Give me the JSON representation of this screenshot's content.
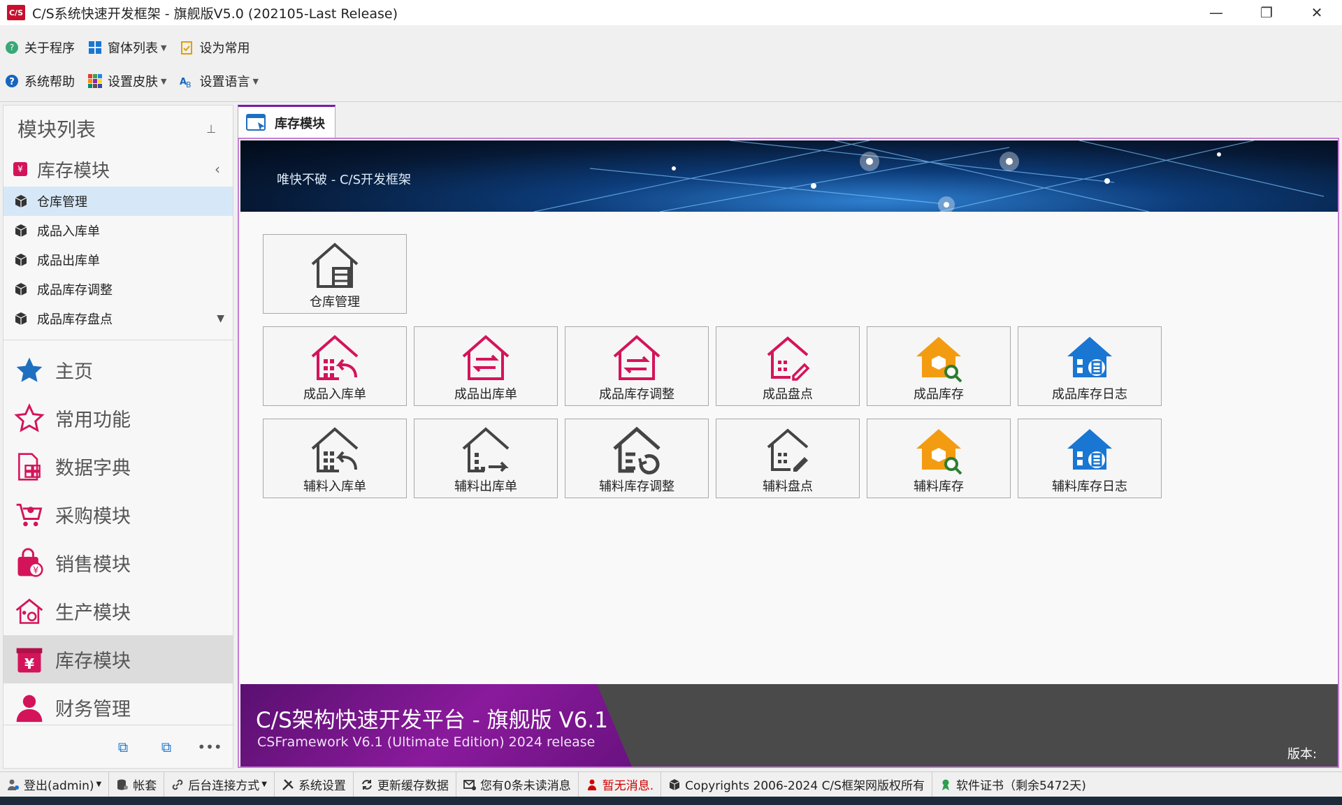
{
  "window": {
    "title": "C/S系统快速开发框架 - 旗舰版V5.0 (202105-Last Release)",
    "logo_text": "C/S",
    "minimize": "—",
    "restore": "❐",
    "close": "✕"
  },
  "toolbar": {
    "row1": [
      {
        "label": "关于程序",
        "icon": "about-icon",
        "dropdown": false
      },
      {
        "label": "窗体列表",
        "icon": "window-list-icon",
        "dropdown": true
      },
      {
        "label": "设为常用",
        "icon": "clipboard-check-icon",
        "dropdown": false
      }
    ],
    "row2": [
      {
        "label": "系统帮助",
        "icon": "help-icon",
        "dropdown": false
      },
      {
        "label": "设置皮肤",
        "icon": "skin-grid-icon",
        "dropdown": true
      },
      {
        "label": "设置语言",
        "icon": "language-icon",
        "dropdown": true
      }
    ]
  },
  "sidebar": {
    "header": "模块列表",
    "pin": "📌",
    "group": {
      "label": "库存模块",
      "collapse": "‹"
    },
    "items": [
      {
        "label": "仓库管理",
        "selected": true
      },
      {
        "label": "成品入库单",
        "selected": false
      },
      {
        "label": "成品出库单",
        "selected": false
      },
      {
        "label": "成品库存调整",
        "selected": false
      },
      {
        "label": "成品库存盘点",
        "selected": false
      }
    ],
    "nav": [
      {
        "label": "主页",
        "icon": "star-filled-icon",
        "active": false
      },
      {
        "label": "常用功能",
        "icon": "star-outline-icon",
        "active": false
      },
      {
        "label": "数据字典",
        "icon": "dictionary-icon",
        "active": false
      },
      {
        "label": "采购模块",
        "icon": "cart-icon",
        "active": false
      },
      {
        "label": "销售模块",
        "icon": "shopping-bag-icon",
        "active": false
      },
      {
        "label": "生产模块",
        "icon": "factory-icon",
        "active": false
      },
      {
        "label": "库存模块",
        "icon": "inventory-icon",
        "active": true
      },
      {
        "label": "财务管理",
        "icon": "person-icon",
        "active": false
      }
    ],
    "footer_more": "•••"
  },
  "tab": {
    "label": "库存模块"
  },
  "banner": {
    "slogan": "唯快不破 - C/S开发框架"
  },
  "tiles": [
    {
      "label": "仓库管理",
      "icon": "warehouse-icon",
      "color": "#444444"
    },
    {
      "label": "成品入库单",
      "icon": "product-in-icon",
      "color": "#d4145a"
    },
    {
      "label": "成品出库单",
      "icon": "product-out-icon",
      "color": "#d4145a"
    },
    {
      "label": "成品库存调整",
      "icon": "product-adjust-icon",
      "color": "#d4145a"
    },
    {
      "label": "成品盘点",
      "icon": "product-count-icon",
      "color": "#d4145a"
    },
    {
      "label": "成品库存",
      "icon": "product-stock-search-icon",
      "color": "#f39c12"
    },
    {
      "label": "成品库存日志",
      "icon": "product-stock-log-icon",
      "color": "#1976d2"
    },
    {
      "label": "辅料入库单",
      "icon": "material-in-icon",
      "color": "#444444"
    },
    {
      "label": "辅料出库单",
      "icon": "material-out-icon",
      "color": "#444444"
    },
    {
      "label": "辅料库存调整",
      "icon": "material-adjust-icon",
      "color": "#444444"
    },
    {
      "label": "辅料盘点",
      "icon": "material-count-icon",
      "color": "#444444"
    },
    {
      "label": "辅料库存",
      "icon": "material-stock-search-icon",
      "color": "#f39c12"
    },
    {
      "label": "辅料库存日志",
      "icon": "material-stock-log-icon",
      "color": "#1976d2"
    }
  ],
  "bottom_banner": {
    "title": "C/S架构快速开发平台 - 旗舰版 V6.1",
    "subtitle": "CSFramework V6.1 (Ultimate Edition) 2024 release",
    "version_label": "版本:"
  },
  "statusbar": [
    {
      "label": "登出(admin)",
      "icon": "user-gear-icon",
      "dropdown": true,
      "red": false
    },
    {
      "label": "帐套",
      "icon": "database-icon",
      "dropdown": false,
      "red": false
    },
    {
      "label": "后台连接方式",
      "icon": "link-icon",
      "dropdown": true,
      "red": false
    },
    {
      "label": "系统设置",
      "icon": "tools-icon",
      "dropdown": false,
      "red": false
    },
    {
      "label": "更新缓存数据",
      "icon": "refresh-icon",
      "dropdown": false,
      "red": false
    },
    {
      "label": "您有0条未读消息",
      "icon": "mail-icon",
      "dropdown": false,
      "red": false
    },
    {
      "label": "暂无消息.",
      "icon": "alert-person-icon",
      "dropdown": false,
      "red": true
    },
    {
      "label": "Copyrights 2006-2024 C/S框架网版权所有",
      "icon": "cube-icon",
      "dropdown": false,
      "red": false
    },
    {
      "label": "软件证书（剩余5472天)",
      "icon": "certificate-icon",
      "dropdown": false,
      "red": false
    }
  ],
  "colors": {
    "accent": "#7a1aa8",
    "pink": "#d4145a",
    "orange": "#f39c12",
    "blue": "#1976d2"
  }
}
